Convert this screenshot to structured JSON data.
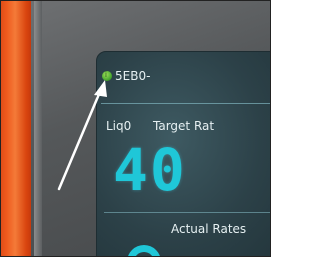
{
  "display": {
    "device_id": "5EB0-",
    "product": "Liq0",
    "target_rate_label": "Target Rat",
    "target_rate_value": "40",
    "actual_rate_label": "Actual Rates"
  },
  "icons": {
    "status": "status-indicator-icon",
    "status_glyph": "i",
    "annotation": "pointer-arrow-icon"
  },
  "colors": {
    "digits": "#1fc7d8",
    "status_indicator": "#5bc43a",
    "housing": "#ef5a1d"
  }
}
